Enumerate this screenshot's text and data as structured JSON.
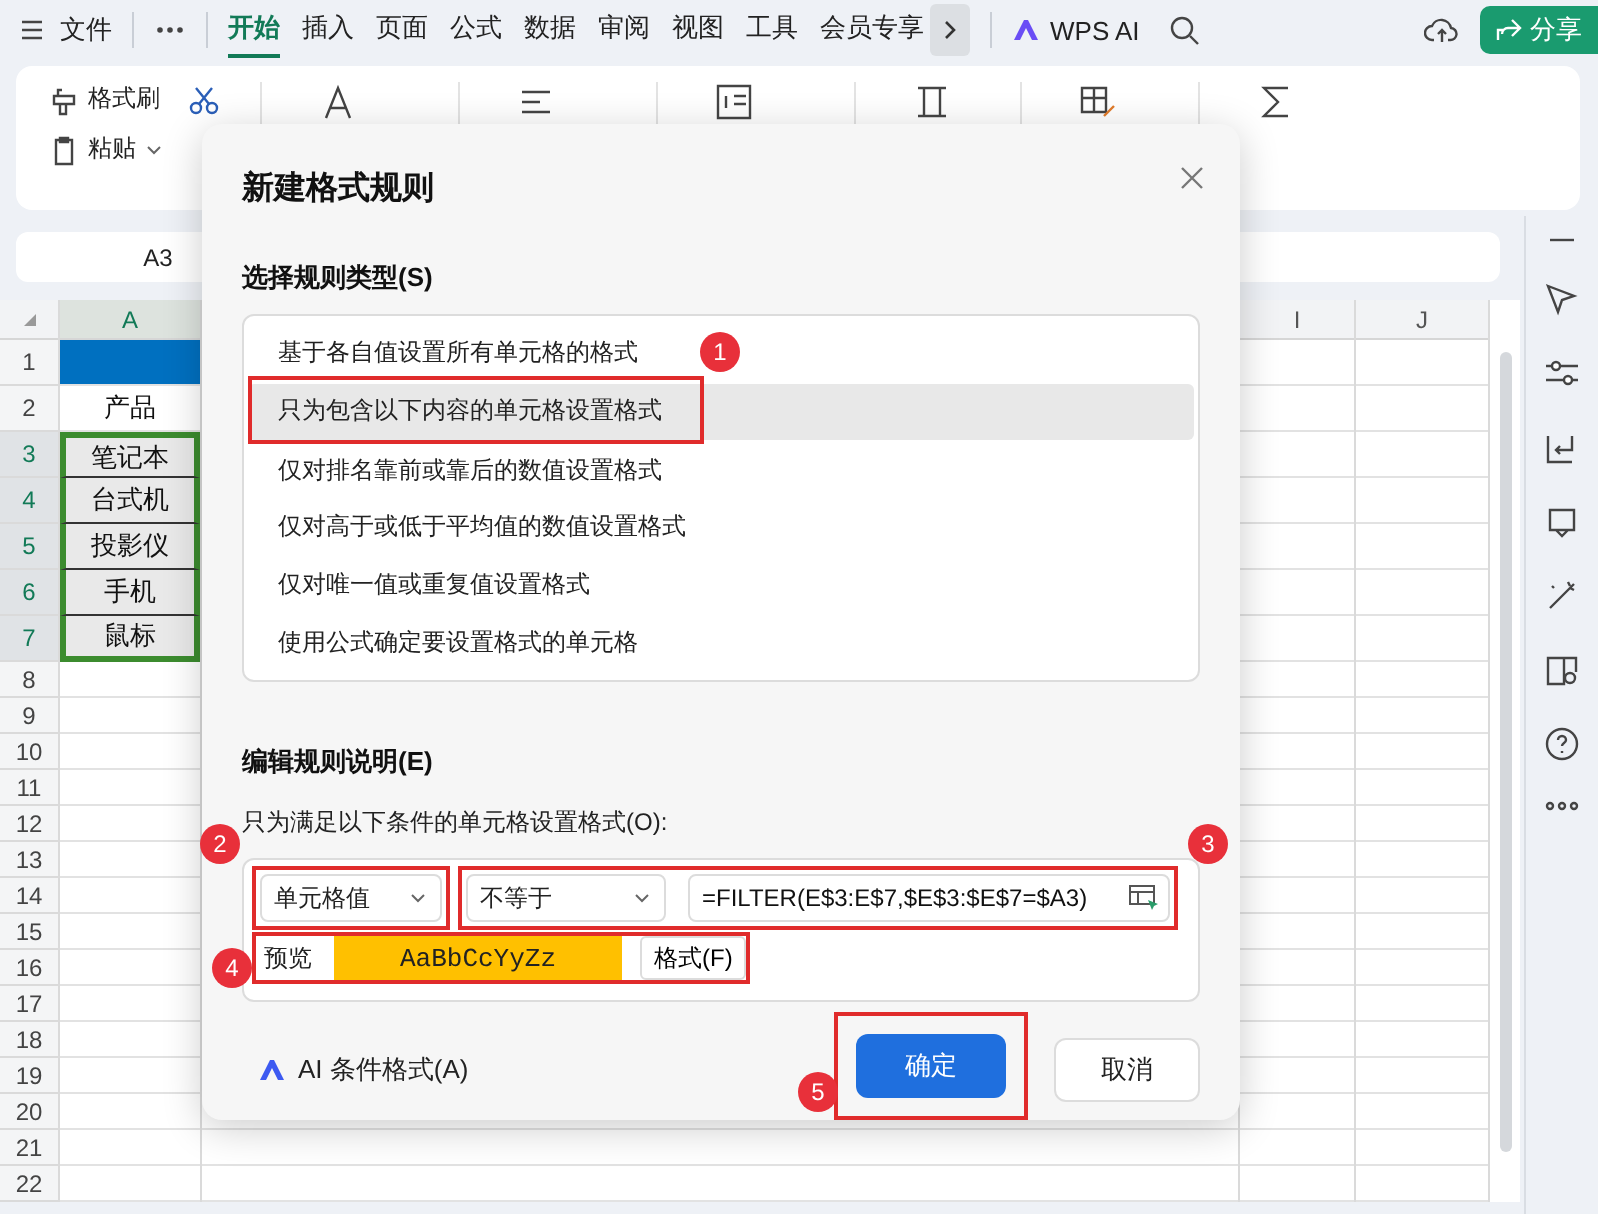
{
  "menu_bar": {
    "file": "文件",
    "tabs": [
      {
        "label": "开始",
        "selected": true
      },
      {
        "label": "插入",
        "selected": false
      },
      {
        "label": "页面",
        "selected": false
      },
      {
        "label": "公式",
        "selected": false
      },
      {
        "label": "数据",
        "selected": false
      },
      {
        "label": "审阅",
        "selected": false
      },
      {
        "label": "视图",
        "selected": false
      },
      {
        "label": "工具",
        "selected": false
      },
      {
        "label": "会员专享",
        "selected": false
      }
    ],
    "ai": "WPS AI",
    "share": "分享"
  },
  "ribbon": {
    "format_painter": "格式刷",
    "paste": "粘贴"
  },
  "name_box": "A3",
  "sheet": {
    "columns": [
      {
        "label": "A",
        "selected": true
      },
      {
        "label": "I",
        "selected": false
      },
      {
        "label": "J",
        "selected": false
      }
    ],
    "rows": [
      {
        "number": "1",
        "selected": false,
        "kind": "banner"
      },
      {
        "number": "2",
        "selected": false,
        "kind": "text",
        "a": "产品"
      },
      {
        "number": "3",
        "selected": true,
        "kind": "text",
        "a": "笔记本"
      },
      {
        "number": "4",
        "selected": true,
        "kind": "text",
        "a": "台式机"
      },
      {
        "number": "5",
        "selected": true,
        "kind": "text",
        "a": "投影仪"
      },
      {
        "number": "6",
        "selected": true,
        "kind": "text",
        "a": "手机"
      },
      {
        "number": "7",
        "selected": true,
        "kind": "text",
        "a": "鼠标"
      },
      {
        "number": "8",
        "selected": false,
        "kind": "empty"
      },
      {
        "number": "9",
        "selected": false,
        "kind": "empty"
      },
      {
        "number": "10",
        "selected": false,
        "kind": "empty"
      },
      {
        "number": "11",
        "selected": false,
        "kind": "empty"
      },
      {
        "number": "12",
        "selected": false,
        "kind": "empty"
      },
      {
        "number": "13",
        "selected": false,
        "kind": "empty"
      },
      {
        "number": "14",
        "selected": false,
        "kind": "empty"
      },
      {
        "number": "15",
        "selected": false,
        "kind": "empty"
      },
      {
        "number": "16",
        "selected": false,
        "kind": "empty"
      },
      {
        "number": "17",
        "selected": false,
        "kind": "empty"
      },
      {
        "number": "18",
        "selected": false,
        "kind": "empty"
      },
      {
        "number": "19",
        "selected": false,
        "kind": "empty"
      },
      {
        "number": "20",
        "selected": false,
        "kind": "empty"
      },
      {
        "number": "21",
        "selected": false,
        "kind": "empty"
      },
      {
        "number": "22",
        "selected": false,
        "kind": "empty"
      }
    ]
  },
  "dialog": {
    "title": "新建格式规则",
    "rule_type_heading": "选择规则类型(S)",
    "rule_types": [
      {
        "label": "基于各自值设置所有单元格的格式",
        "selected": false
      },
      {
        "label": "只为包含以下内容的单元格设置格式",
        "selected": true
      },
      {
        "label": "仅对排名靠前或靠后的数值设置格式",
        "selected": false
      },
      {
        "label": "仅对高于或低于平均值的数值设置格式",
        "selected": false
      },
      {
        "label": "仅对唯一值或重复值设置格式",
        "selected": false
      },
      {
        "label": "使用公式确定要设置格式的单元格",
        "selected": false
      }
    ],
    "description_heading": "编辑规则说明(E)",
    "condition_label": "只为满足以下条件的单元格设置格式(O):",
    "value_dropdown": "单元格值",
    "operator_dropdown": "不等于",
    "formula": "=FILTER(E$3:E$7,$E$3:$E$7=$A3)",
    "preview_label": "预览",
    "preview_sample": "AaBbCcYyZz",
    "format_button": "格式(F)",
    "ai_button": "AI 条件格式(A)",
    "ok_button": "确定",
    "cancel_button": "取消"
  },
  "annotations": [
    {
      "number": "1"
    },
    {
      "number": "2"
    },
    {
      "number": "3"
    },
    {
      "number": "4"
    },
    {
      "number": "5"
    }
  ]
}
